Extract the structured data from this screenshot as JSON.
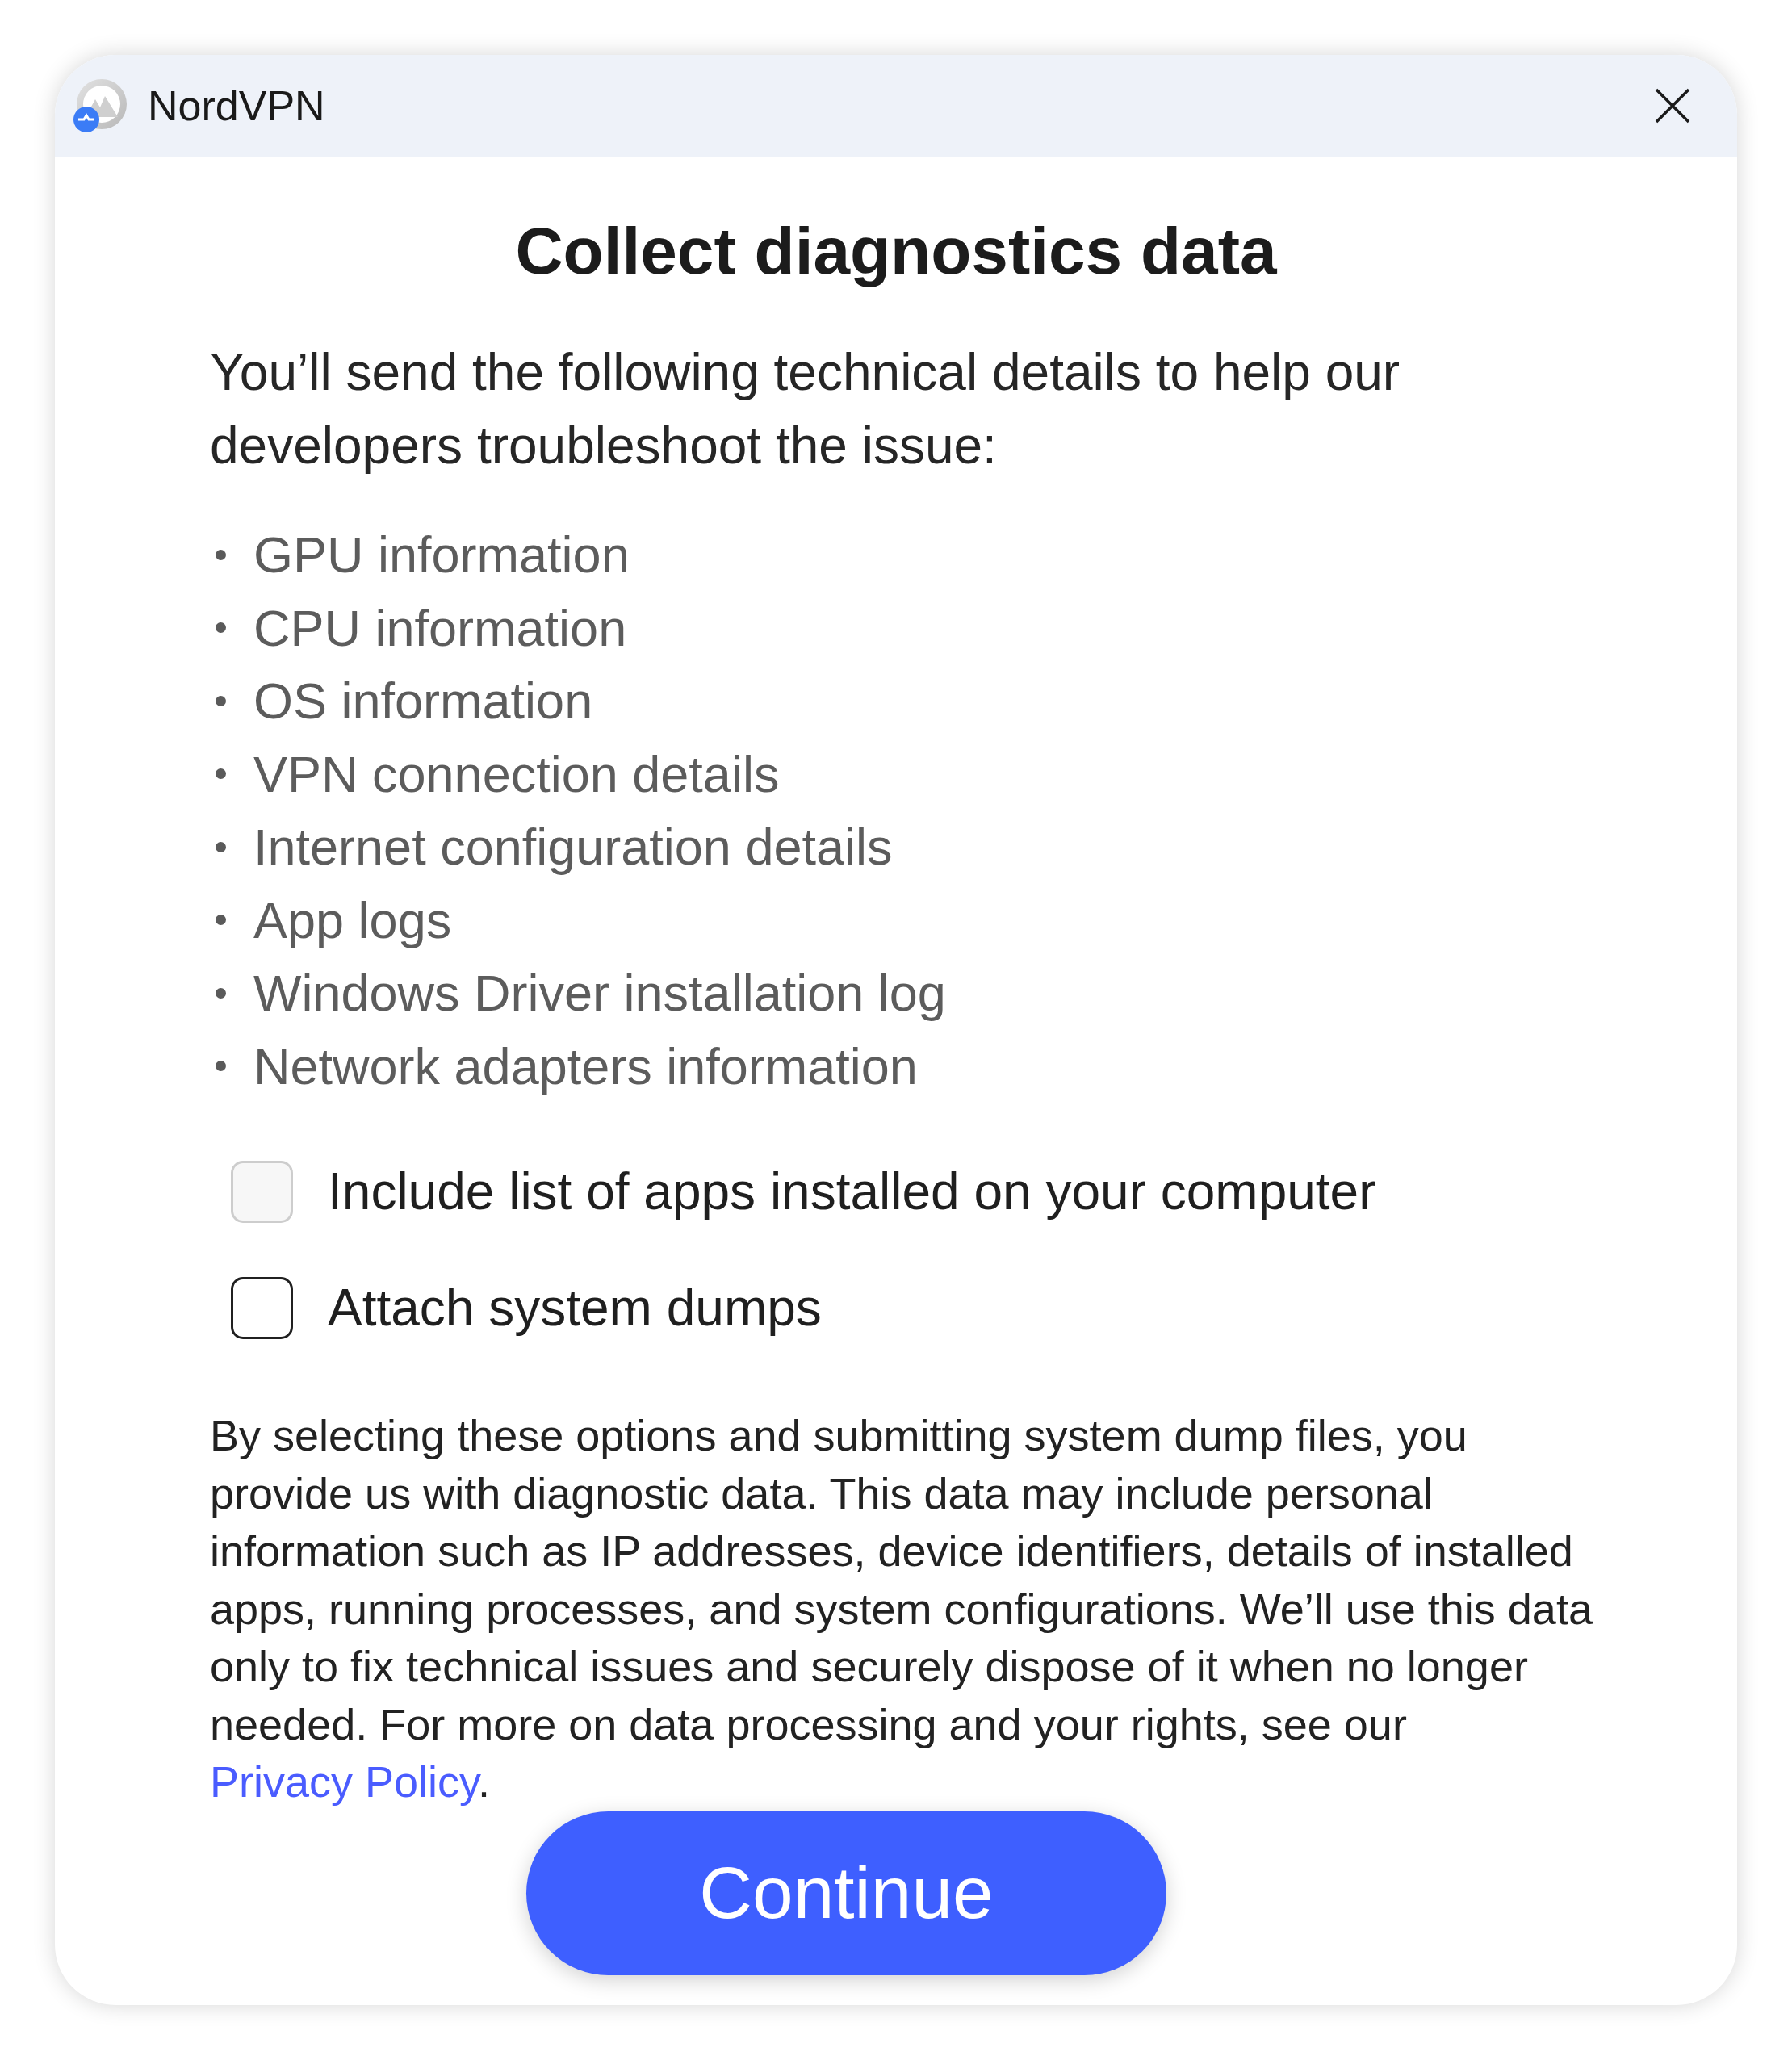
{
  "window": {
    "title": "NordVPN"
  },
  "dialog": {
    "heading": "Collect diagnostics data",
    "intro": "You’ll send the following technical details to help our developers troubleshoot the issue:",
    "details": [
      "GPU information",
      "CPU information",
      "OS information",
      "VPN connection details",
      "Internet configuration details",
      "App logs",
      "Windows Driver installation log",
      "Network adapters information"
    ],
    "options": [
      {
        "label": "Include list of apps installed on your computer",
        "checked": false,
        "disabled": true
      },
      {
        "label": "Attach system dumps",
        "checked": false,
        "disabled": false
      }
    ],
    "disclaimer": {
      "text": "By selecting these options and submitting system dump files, you provide us with diagnostic data. This data may include personal information such as IP addresses, device identifiers, details of installed apps, running processes, and system configurations. We’ll use this data only to fix technical issues and securely dispose of it when no longer needed. For more on data processing and your rights, see our",
      "link": "Privacy Policy",
      "end": "."
    },
    "button": "Continue"
  }
}
